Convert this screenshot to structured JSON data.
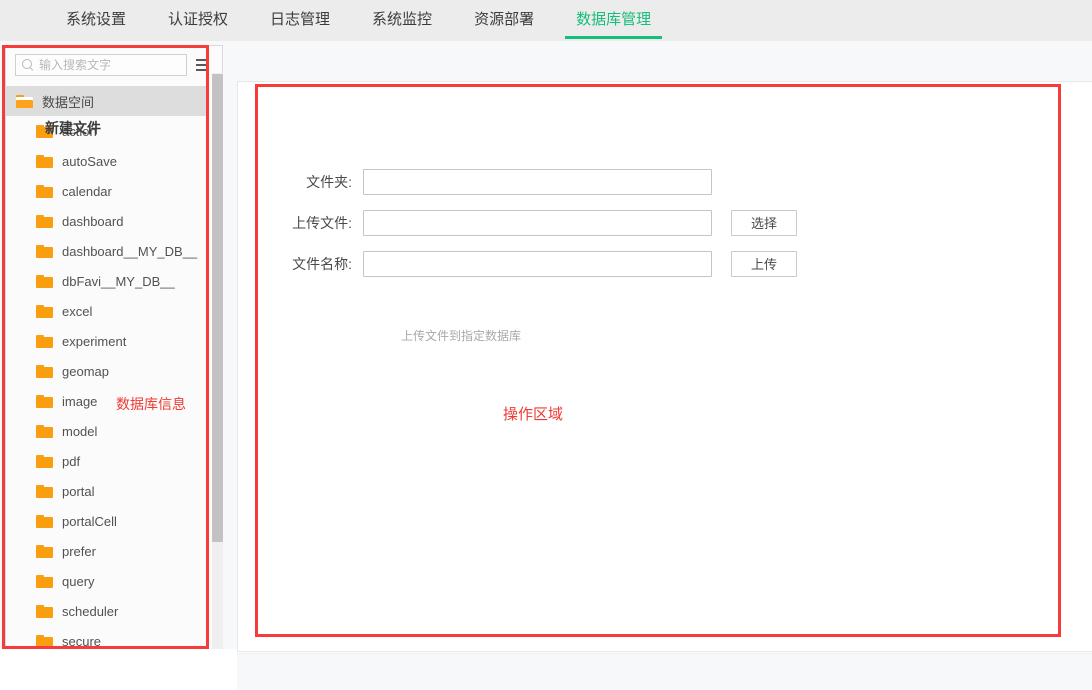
{
  "header": {
    "tabs": [
      {
        "label": "系统设置",
        "active": false
      },
      {
        "label": "认证授权",
        "active": false
      },
      {
        "label": "日志管理",
        "active": false
      },
      {
        "label": "系统监控",
        "active": false
      },
      {
        "label": "资源部署",
        "active": false
      },
      {
        "label": "数据库管理",
        "active": true
      }
    ],
    "active_color": "#17bd7a"
  },
  "sidebar": {
    "search": {
      "placeholder": "输入搜索文字",
      "value": "",
      "icon": "search-icon"
    },
    "menu_icon": "hamburger-icon",
    "tree": {
      "root": {
        "label": "数据空间",
        "icon": "folder-open-icon",
        "selected": true
      },
      "items": [
        {
          "label": "action",
          "icon": "folder-icon"
        },
        {
          "label": "autoSave",
          "icon": "folder-icon"
        },
        {
          "label": "calendar",
          "icon": "folder-icon"
        },
        {
          "label": "dashboard",
          "icon": "folder-icon"
        },
        {
          "label": "dashboard__MY_DB__",
          "icon": "folder-icon"
        },
        {
          "label": "dbFavi__MY_DB__",
          "icon": "folder-icon"
        },
        {
          "label": "excel",
          "icon": "folder-icon"
        },
        {
          "label": "experiment",
          "icon": "folder-icon"
        },
        {
          "label": "geomap",
          "icon": "folder-icon"
        },
        {
          "label": "image",
          "icon": "folder-icon"
        },
        {
          "label": "model",
          "icon": "folder-icon"
        },
        {
          "label": "pdf",
          "icon": "folder-icon"
        },
        {
          "label": "portal",
          "icon": "folder-icon"
        },
        {
          "label": "portalCell",
          "icon": "folder-icon"
        },
        {
          "label": "prefer",
          "icon": "folder-icon"
        },
        {
          "label": "query",
          "icon": "folder-icon"
        },
        {
          "label": "scheduler",
          "icon": "folder-icon"
        },
        {
          "label": "secure",
          "icon": "folder-icon"
        }
      ]
    },
    "folder_color": "#fa9e10"
  },
  "main": {
    "card_title": "新建文件",
    "form": {
      "rows": [
        {
          "label": "文件夹:",
          "value": "",
          "placeholder": "",
          "button": ""
        },
        {
          "label": "上传文件:",
          "value": "",
          "placeholder": "",
          "button": "选择"
        },
        {
          "label": "文件名称:",
          "value": "",
          "placeholder": "",
          "button": "上传"
        }
      ],
      "hint": "上传文件到指定数据库"
    }
  },
  "annotations": {
    "color": "#ee3b33",
    "sidebar_label": "数据库信息",
    "main_label": "操作区域"
  }
}
